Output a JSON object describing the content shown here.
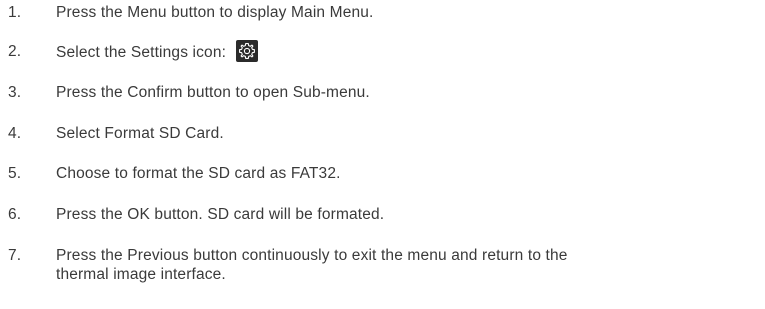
{
  "steps": [
    {
      "number": "1.",
      "text": "Press the Menu button to display Main Menu."
    },
    {
      "number": "2.",
      "text": "Select the Settings icon:",
      "icon": "gear-icon"
    },
    {
      "number": "3.",
      "text": "Press the Confirm button to open Sub-menu."
    },
    {
      "number": "4.",
      "text": "Select Format SD Card."
    },
    {
      "number": "5.",
      "text": "Choose to format the SD card as FAT32."
    },
    {
      "number": "6.",
      "text": "Press the OK button. SD card will be formated."
    },
    {
      "number": "7.",
      "text_line1": "Press the Previous button continuously to exit the menu and return to the",
      "text_line2": "thermal image interface."
    }
  ],
  "colors": {
    "text": "#3a3a3a",
    "icon_background": "#2b2b2b",
    "icon_foreground": "#ffffff"
  }
}
